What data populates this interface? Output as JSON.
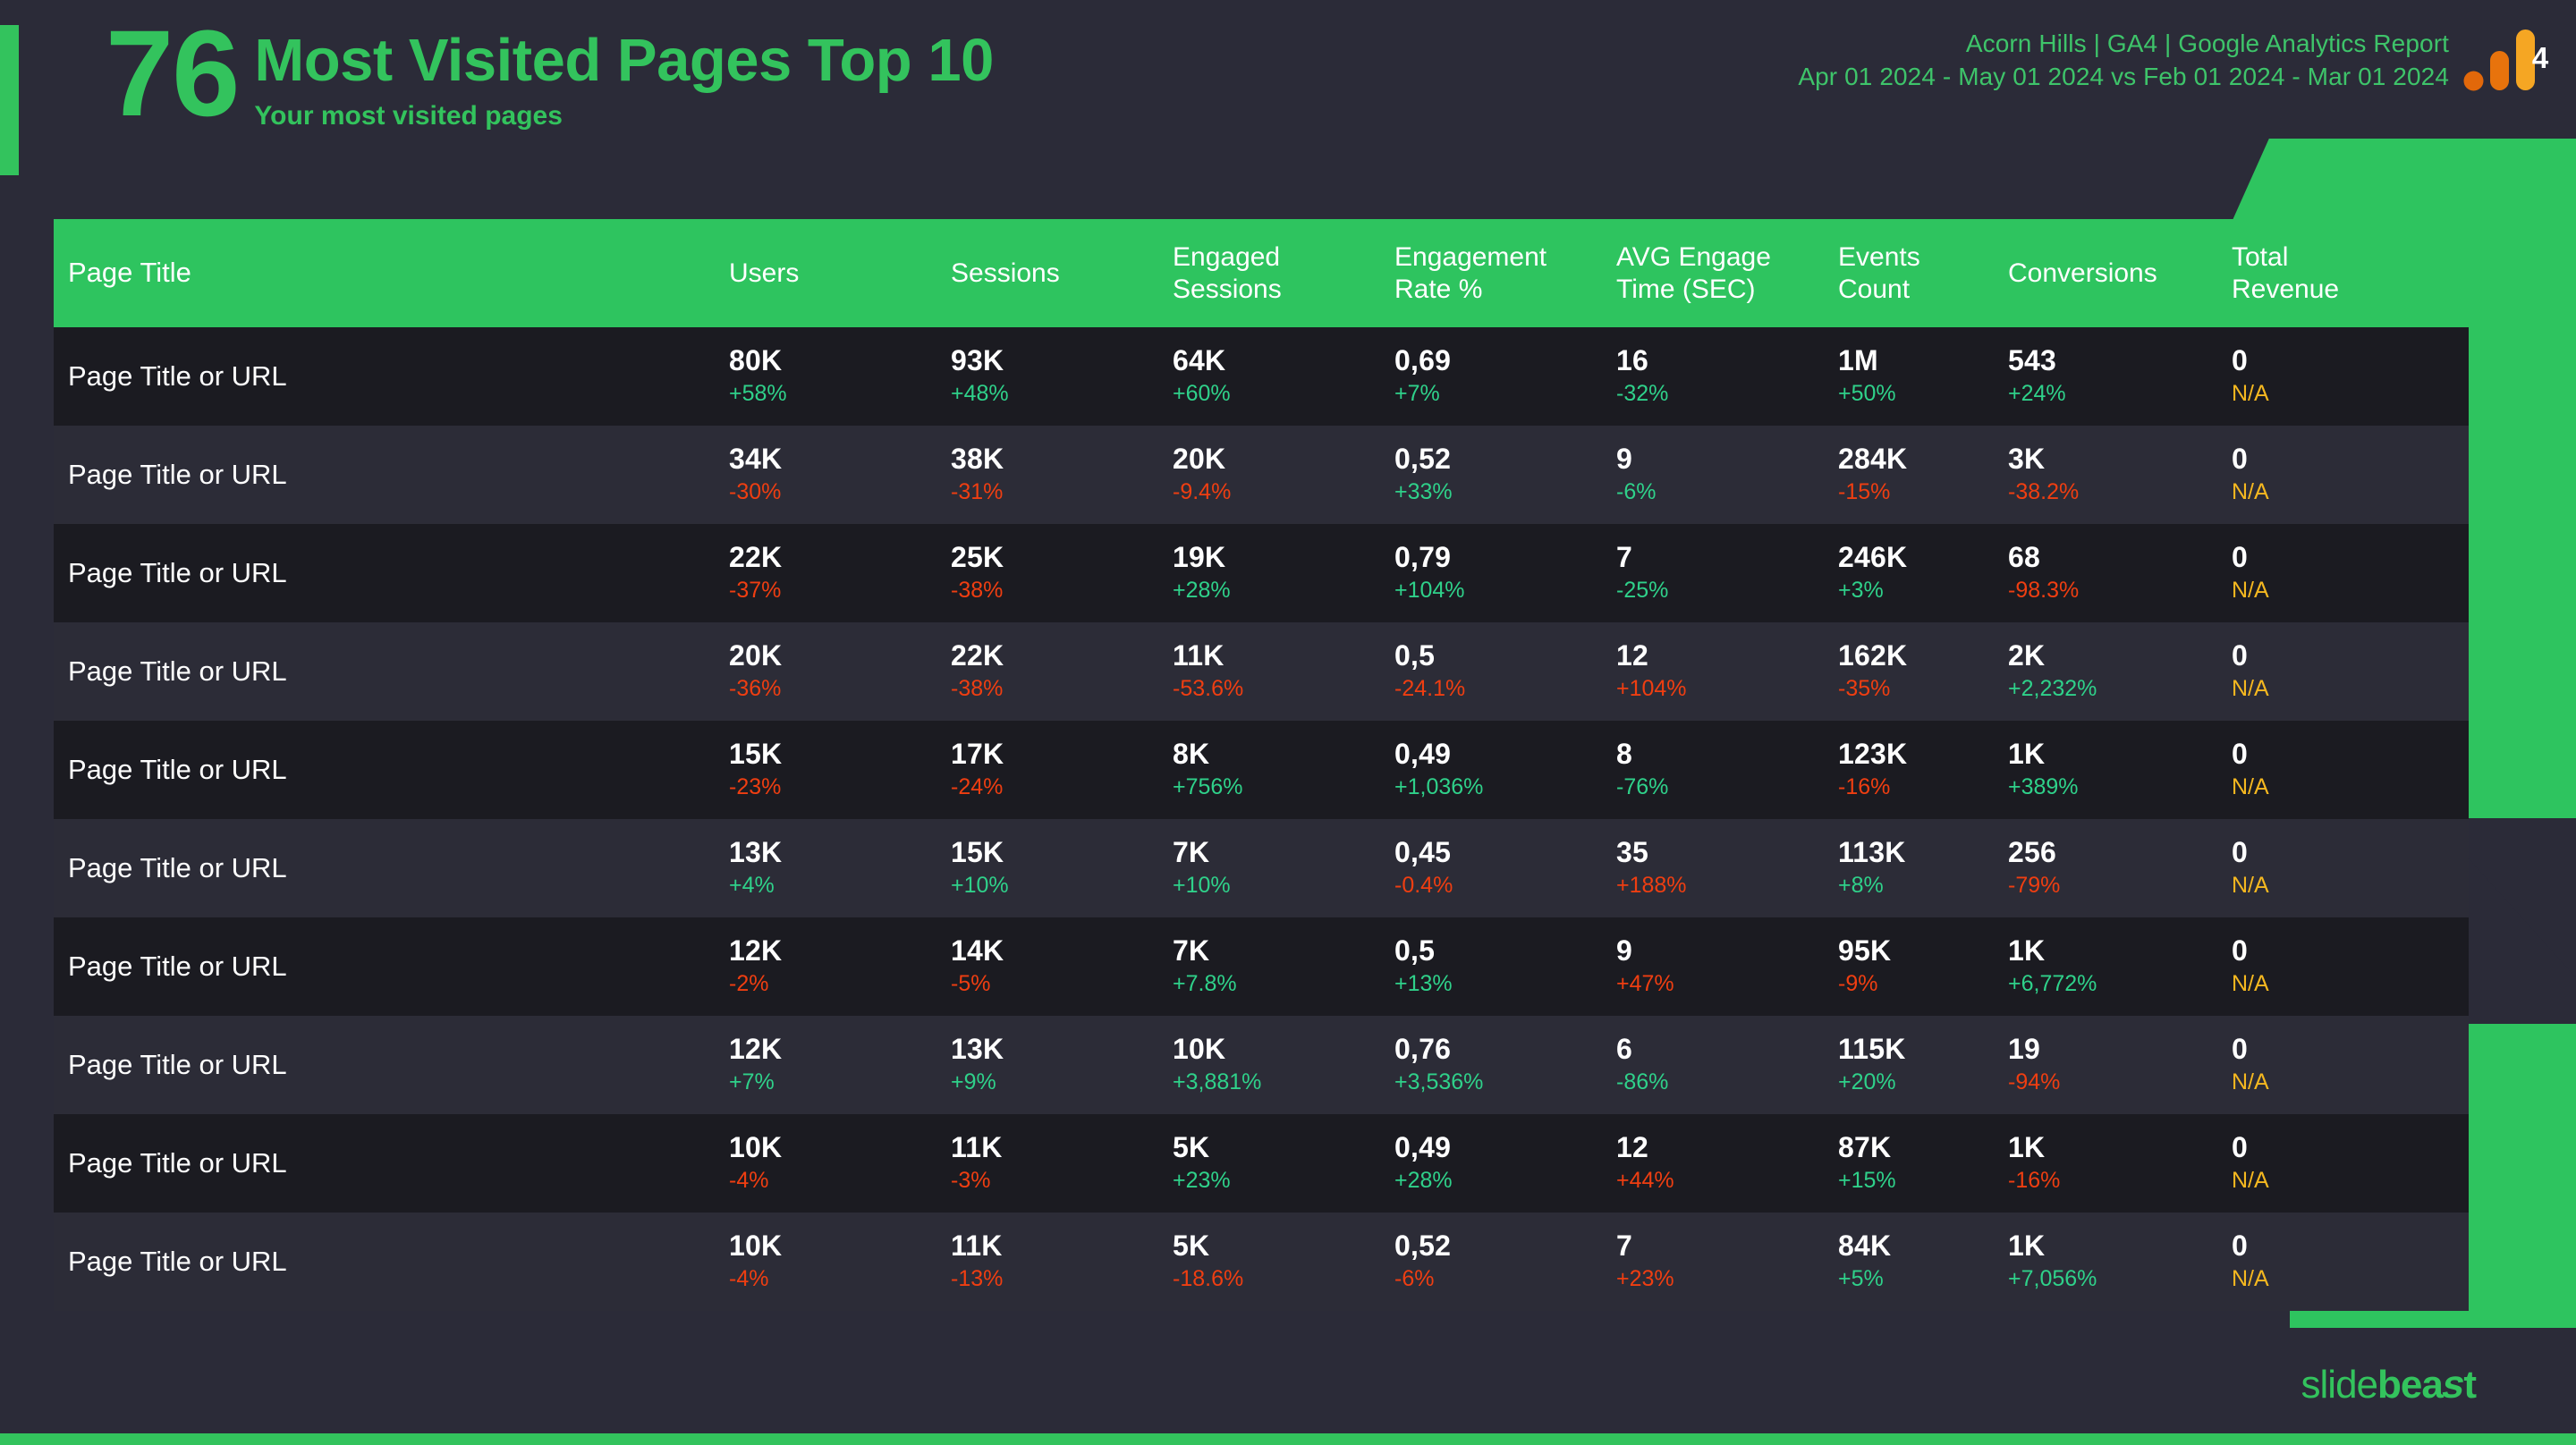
{
  "header": {
    "kpi_number": "76",
    "title": "Most Visited Pages Top 10",
    "subtitle": "Your most visited pages",
    "report_name": "Acorn Hills | GA4 | Google Analytics Report",
    "date_range": "Apr 01 2024 - May 01 2024 vs Feb 01 2024 - Mar 01 2024",
    "logo_badge": "4",
    "logo_icon": "ga4-analytics-icon"
  },
  "colors": {
    "accent_green": "#33c35d",
    "header_green": "#2ec45f",
    "background": "#2b2b38",
    "row_dark": "#1b1b21",
    "row_light": "#2c2c37",
    "positive": "#2fd18a",
    "negative": "#ef3e11",
    "na": "#f5b820"
  },
  "footer": {
    "brand_part1": "slide",
    "brand_part2": "bea",
    "brand_bolt": "s",
    "brand_part3": "t"
  },
  "table": {
    "columns": [
      "Page Title",
      "Users",
      "Sessions",
      "Engaged Sessions",
      "Engagement Rate %",
      "AVG Engage Time (SEC)",
      "Events Count",
      "Conversions",
      "Total Revenue"
    ],
    "columns_wrapped": [
      [
        "Page Title"
      ],
      [
        "Users"
      ],
      [
        "Sessions"
      ],
      [
        "Engaged",
        "Sessions"
      ],
      [
        "Engagement",
        "Rate %"
      ],
      [
        "AVG Engage",
        "Time (SEC)"
      ],
      [
        "Events",
        "Count"
      ],
      [
        "Conversions"
      ],
      [
        "Total",
        "Revenue"
      ]
    ],
    "rows": [
      {
        "page": "Page Title or URL",
        "users": {
          "value": "80K",
          "delta": "+58%",
          "dir": "up"
        },
        "sessions": {
          "value": "93K",
          "delta": "+48%",
          "dir": "up"
        },
        "engaged_sessions": {
          "value": "64K",
          "delta": "+60%",
          "dir": "up"
        },
        "engagement_rate": {
          "value": "0,69",
          "delta": "+7%",
          "dir": "up"
        },
        "avg_engage_time": {
          "value": "16",
          "delta": "-32%",
          "dir": "up"
        },
        "events_count": {
          "value": "1M",
          "delta": "+50%",
          "dir": "up"
        },
        "conversions": {
          "value": "543",
          "delta": "+24%",
          "dir": "up"
        },
        "total_revenue": {
          "value": "0",
          "delta": "N/A",
          "dir": "na"
        }
      },
      {
        "page": "Page Title or URL",
        "users": {
          "value": "34K",
          "delta": "-30%",
          "dir": "down"
        },
        "sessions": {
          "value": "38K",
          "delta": "-31%",
          "dir": "down"
        },
        "engaged_sessions": {
          "value": "20K",
          "delta": "-9.4%",
          "dir": "down"
        },
        "engagement_rate": {
          "value": "0,52",
          "delta": "+33%",
          "dir": "up"
        },
        "avg_engage_time": {
          "value": "9",
          "delta": "-6%",
          "dir": "up"
        },
        "events_count": {
          "value": "284K",
          "delta": "-15%",
          "dir": "down"
        },
        "conversions": {
          "value": "3K",
          "delta": "-38.2%",
          "dir": "down"
        },
        "total_revenue": {
          "value": "0",
          "delta": "N/A",
          "dir": "na"
        }
      },
      {
        "page": "Page Title or URL",
        "users": {
          "value": "22K",
          "delta": "-37%",
          "dir": "down"
        },
        "sessions": {
          "value": "25K",
          "delta": "-38%",
          "dir": "down"
        },
        "engaged_sessions": {
          "value": "19K",
          "delta": "+28%",
          "dir": "up"
        },
        "engagement_rate": {
          "value": "0,79",
          "delta": "+104%",
          "dir": "up"
        },
        "avg_engage_time": {
          "value": "7",
          "delta": "-25%",
          "dir": "up"
        },
        "events_count": {
          "value": "246K",
          "delta": "+3%",
          "dir": "up"
        },
        "conversions": {
          "value": "68",
          "delta": "-98.3%",
          "dir": "down"
        },
        "total_revenue": {
          "value": "0",
          "delta": "N/A",
          "dir": "na"
        }
      },
      {
        "page": "Page Title or URL",
        "users": {
          "value": "20K",
          "delta": "-36%",
          "dir": "down"
        },
        "sessions": {
          "value": "22K",
          "delta": "-38%",
          "dir": "down"
        },
        "engaged_sessions": {
          "value": "11K",
          "delta": "-53.6%",
          "dir": "down"
        },
        "engagement_rate": {
          "value": "0,5",
          "delta": "-24.1%",
          "dir": "down"
        },
        "avg_engage_time": {
          "value": "12",
          "delta": "+104%",
          "dir": "down"
        },
        "events_count": {
          "value": "162K",
          "delta": "-35%",
          "dir": "down"
        },
        "conversions": {
          "value": "2K",
          "delta": "+2,232%",
          "dir": "up"
        },
        "total_revenue": {
          "value": "0",
          "delta": "N/A",
          "dir": "na"
        }
      },
      {
        "page": "Page Title or URL",
        "users": {
          "value": "15K",
          "delta": "-23%",
          "dir": "down"
        },
        "sessions": {
          "value": "17K",
          "delta": "-24%",
          "dir": "down"
        },
        "engaged_sessions": {
          "value": "8K",
          "delta": "+756%",
          "dir": "up"
        },
        "engagement_rate": {
          "value": "0,49",
          "delta": "+1,036%",
          "dir": "up"
        },
        "avg_engage_time": {
          "value": "8",
          "delta": "-76%",
          "dir": "up"
        },
        "events_count": {
          "value": "123K",
          "delta": "-16%",
          "dir": "down"
        },
        "conversions": {
          "value": "1K",
          "delta": "+389%",
          "dir": "up"
        },
        "total_revenue": {
          "value": "0",
          "delta": "N/A",
          "dir": "na"
        }
      },
      {
        "page": "Page Title or URL",
        "users": {
          "value": "13K",
          "delta": "+4%",
          "dir": "up"
        },
        "sessions": {
          "value": "15K",
          "delta": "+10%",
          "dir": "up"
        },
        "engaged_sessions": {
          "value": "7K",
          "delta": "+10%",
          "dir": "up"
        },
        "engagement_rate": {
          "value": "0,45",
          "delta": "-0.4%",
          "dir": "down"
        },
        "avg_engage_time": {
          "value": "35",
          "delta": "+188%",
          "dir": "down"
        },
        "events_count": {
          "value": "113K",
          "delta": "+8%",
          "dir": "up"
        },
        "conversions": {
          "value": "256",
          "delta": "-79%",
          "dir": "down"
        },
        "total_revenue": {
          "value": "0",
          "delta": "N/A",
          "dir": "na"
        }
      },
      {
        "page": "Page Title or URL",
        "users": {
          "value": "12K",
          "delta": "-2%",
          "dir": "down"
        },
        "sessions": {
          "value": "14K",
          "delta": "-5%",
          "dir": "down"
        },
        "engaged_sessions": {
          "value": "7K",
          "delta": "+7.8%",
          "dir": "up"
        },
        "engagement_rate": {
          "value": "0,5",
          "delta": "+13%",
          "dir": "up"
        },
        "avg_engage_time": {
          "value": "9",
          "delta": "+47%",
          "dir": "down"
        },
        "events_count": {
          "value": "95K",
          "delta": "-9%",
          "dir": "down"
        },
        "conversions": {
          "value": "1K",
          "delta": "+6,772%",
          "dir": "up"
        },
        "total_revenue": {
          "value": "0",
          "delta": "N/A",
          "dir": "na"
        }
      },
      {
        "page": "Page Title or URL",
        "users": {
          "value": "12K",
          "delta": "+7%",
          "dir": "up"
        },
        "sessions": {
          "value": "13K",
          "delta": "+9%",
          "dir": "up"
        },
        "engaged_sessions": {
          "value": "10K",
          "delta": "+3,881%",
          "dir": "up"
        },
        "engagement_rate": {
          "value": "0,76",
          "delta": "+3,536%",
          "dir": "up"
        },
        "avg_engage_time": {
          "value": "6",
          "delta": "-86%",
          "dir": "up"
        },
        "events_count": {
          "value": "115K",
          "delta": "+20%",
          "dir": "up"
        },
        "conversions": {
          "value": "19",
          "delta": "-94%",
          "dir": "down"
        },
        "total_revenue": {
          "value": "0",
          "delta": "N/A",
          "dir": "na"
        }
      },
      {
        "page": "Page Title or URL",
        "users": {
          "value": "10K",
          "delta": "-4%",
          "dir": "down"
        },
        "sessions": {
          "value": "11K",
          "delta": "-3%",
          "dir": "down"
        },
        "engaged_sessions": {
          "value": "5K",
          "delta": "+23%",
          "dir": "up"
        },
        "engagement_rate": {
          "value": "0,49",
          "delta": "+28%",
          "dir": "up"
        },
        "avg_engage_time": {
          "value": "12",
          "delta": "+44%",
          "dir": "down"
        },
        "events_count": {
          "value": "87K",
          "delta": "+15%",
          "dir": "up"
        },
        "conversions": {
          "value": "1K",
          "delta": "-16%",
          "dir": "down"
        },
        "total_revenue": {
          "value": "0",
          "delta": "N/A",
          "dir": "na"
        }
      },
      {
        "page": "Page Title or URL",
        "users": {
          "value": "10K",
          "delta": "-4%",
          "dir": "down"
        },
        "sessions": {
          "value": "11K",
          "delta": "-13%",
          "dir": "down"
        },
        "engaged_sessions": {
          "value": "5K",
          "delta": "-18.6%",
          "dir": "down"
        },
        "engagement_rate": {
          "value": "0,52",
          "delta": "-6%",
          "dir": "down"
        },
        "avg_engage_time": {
          "value": "7",
          "delta": "+23%",
          "dir": "down"
        },
        "events_count": {
          "value": "84K",
          "delta": "+5%",
          "dir": "up"
        },
        "conversions": {
          "value": "1K",
          "delta": "+7,056%",
          "dir": "up"
        },
        "total_revenue": {
          "value": "0",
          "delta": "N/A",
          "dir": "na"
        }
      }
    ]
  }
}
